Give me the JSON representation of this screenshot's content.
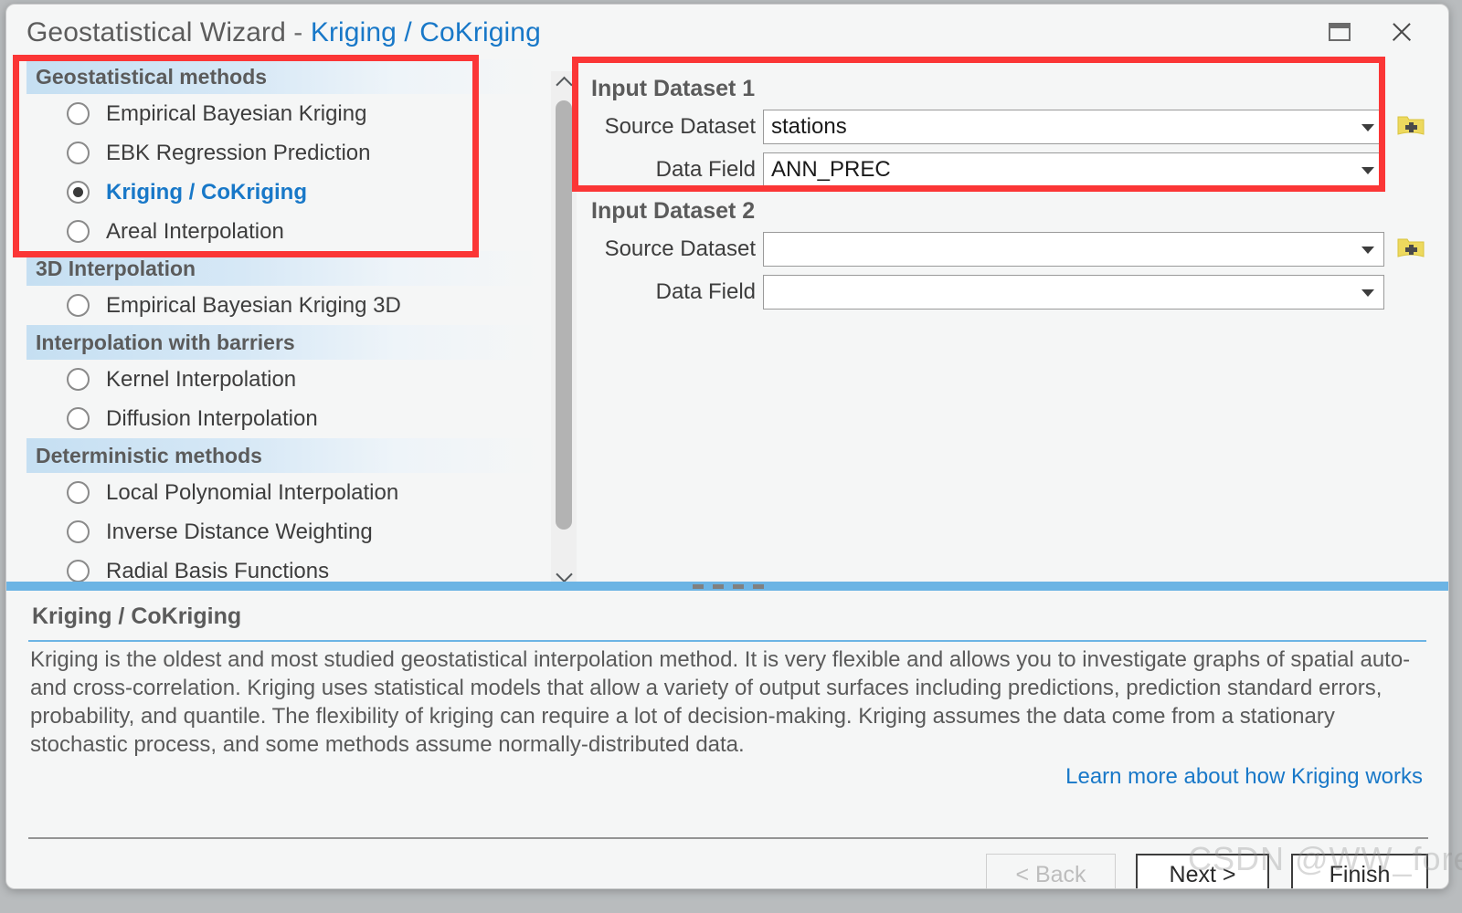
{
  "window": {
    "title_main": "Geostatistical Wizard",
    "title_sep": "-",
    "title_accent": "Kriging / CoKriging",
    "maximize_icon": "maximize-icon",
    "close_icon": "close-icon"
  },
  "methods_panel": {
    "groups": [
      {
        "header": "Geostatistical methods",
        "items": [
          {
            "label": "Empirical Bayesian Kriging",
            "selected": false
          },
          {
            "label": "EBK Regression Prediction",
            "selected": false
          },
          {
            "label": "Kriging / CoKriging",
            "selected": true
          },
          {
            "label": "Areal Interpolation",
            "selected": false
          }
        ]
      },
      {
        "header": "3D Interpolation",
        "items": [
          {
            "label": "Empirical Bayesian Kriging 3D",
            "selected": false
          }
        ]
      },
      {
        "header": "Interpolation with barriers",
        "items": [
          {
            "label": "Kernel Interpolation",
            "selected": false
          },
          {
            "label": "Diffusion Interpolation",
            "selected": false
          }
        ]
      },
      {
        "header": "Deterministic methods",
        "items": [
          {
            "label": "Local Polynomial Interpolation",
            "selected": false
          },
          {
            "label": "Inverse Distance Weighting",
            "selected": false
          },
          {
            "label": "Radial Basis Functions",
            "selected": false
          }
        ]
      }
    ],
    "scrollbar": {
      "up_icon": "chevron-up-icon",
      "down_icon": "chevron-down-icon"
    }
  },
  "input_panel": {
    "dataset1": {
      "title": "Input Dataset 1",
      "source_label": "Source Dataset",
      "source_value": "stations",
      "field_label": "Data Field",
      "field_value": "ANN_PREC",
      "add_icon": "add-dataset-icon"
    },
    "dataset2": {
      "title": "Input Dataset 2",
      "source_label": "Source Dataset",
      "source_value": "",
      "field_label": "Data Field",
      "field_value": "",
      "add_icon": "add-dataset-icon"
    }
  },
  "description": {
    "title": "Kriging / CoKriging",
    "body": "Kriging is the oldest and most studied geostatistical interpolation method. It is very flexible and allows you to investigate graphs of spatial auto- and cross-correlation. Kriging uses statistical models that allow a variety of output surfaces including predictions, prediction standard errors, probability, and quantile. The flexibility of kriging can require a lot of decision-making. Kriging assumes the data come from a stationary stochastic process, and some methods assume normally-distributed data.",
    "link": "Learn more about how Kriging works"
  },
  "footer": {
    "back_label": "< Back",
    "next_label": "Next >",
    "finish_label": "Finish"
  },
  "watermark": {
    "text": "CSDN @WW_forever"
  },
  "colors": {
    "accent_blue": "#1878c8",
    "splitter_blue": "#6cb4e4",
    "annotation_red": "#fb3636",
    "header_gradient_blue": "#c5dff2",
    "folder_yellow": "#edd95e"
  }
}
